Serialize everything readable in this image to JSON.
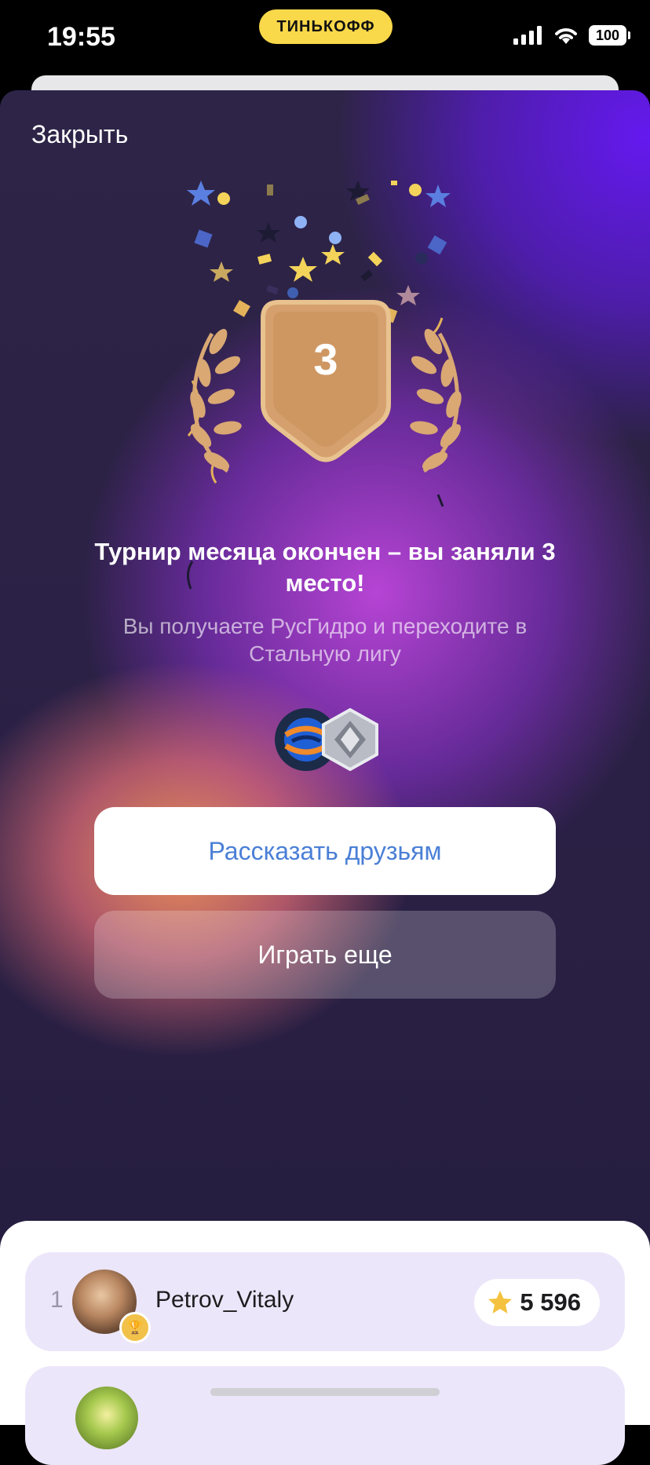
{
  "status_bar": {
    "time": "19:55",
    "carrier_badge": "ТИНЬКОФФ",
    "battery": "100"
  },
  "modal": {
    "close_label": "Закрыть",
    "place_number": "3",
    "title": "Турнир месяца окончен – вы заняли 3 место!",
    "subtitle": "Вы получаете РусГидро и переходите в Стальную лигу",
    "share_button": "Рассказать друзьям",
    "play_again_button": "Играть еще"
  },
  "leaderboard": {
    "rows": [
      {
        "rank": "1",
        "username": "Petrov_Vitaly",
        "score": "5 596"
      }
    ]
  },
  "colors": {
    "accent_blue": "#4a7fd6",
    "bronze": "#d5a06d",
    "row_background": "#ece6fa",
    "carrier_yellow": "#f9d84a"
  }
}
